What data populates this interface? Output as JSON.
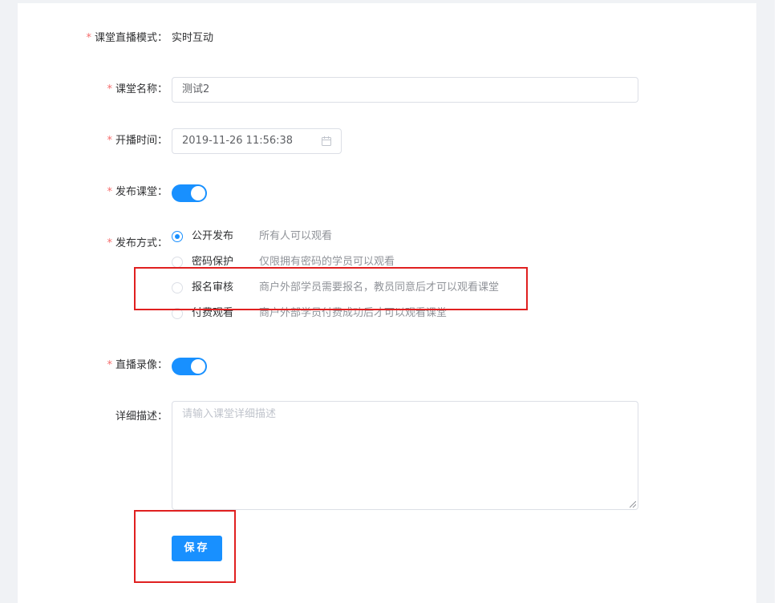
{
  "form": {
    "mode": {
      "label": "课堂直播模式：",
      "value": "实时互动"
    },
    "name": {
      "label": "课堂名称：",
      "value": "测试2"
    },
    "start_time": {
      "label": "开播时间：",
      "value": "2019-11-26 11:56:38"
    },
    "publish": {
      "label": "发布课堂：",
      "enabled": true
    },
    "publish_method": {
      "label": "发布方式：",
      "options": [
        {
          "label": "公开发布",
          "desc": "所有人可以观看",
          "checked": true
        },
        {
          "label": "密码保护",
          "desc": "仅限拥有密码的学员可以观看",
          "checked": false
        },
        {
          "label": "报名审核",
          "desc": "商户外部学员需要报名，教员同意后才可以观看课堂",
          "checked": false
        },
        {
          "label": "付费观看",
          "desc": "商户外部学员付费成功后才可以观看课堂",
          "checked": false
        }
      ]
    },
    "recording": {
      "label": "直播录像：",
      "enabled": true
    },
    "description": {
      "label": "详细描述：",
      "placeholder": "请输入课堂详细描述"
    },
    "save_label": "保存",
    "required_mark": "*"
  },
  "colors": {
    "primary": "#1890ff",
    "required": "#f56c6c",
    "highlight": "#e02020"
  }
}
